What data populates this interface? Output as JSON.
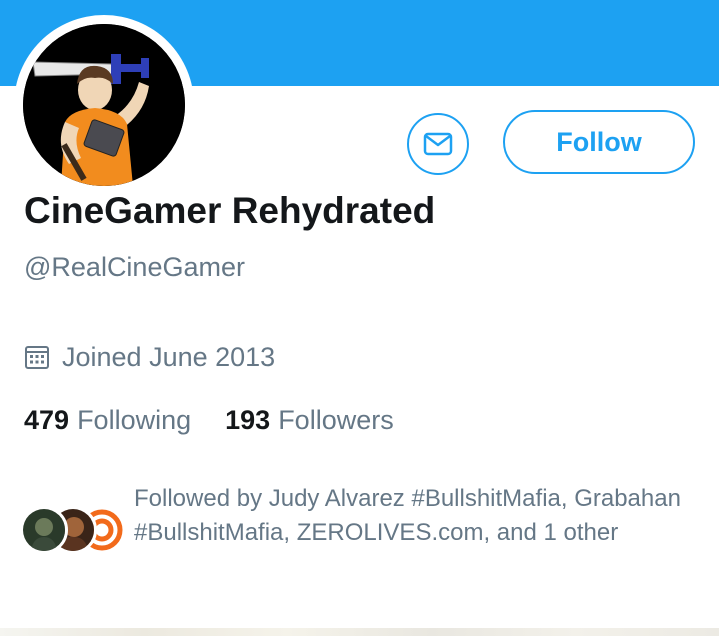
{
  "profile": {
    "display_name": "CineGamer Rehydrated",
    "handle": "@RealCineGamer",
    "joined": "Joined June 2013"
  },
  "actions": {
    "follow_label": "Follow",
    "message_icon": "envelope-icon"
  },
  "stats": [
    {
      "count": "479",
      "label": "Following"
    },
    {
      "count": "193",
      "label": "Followers"
    }
  ],
  "followed_by": {
    "text": "Followed by Judy Alvarez #BullshitMafia, Grabahan #BullshitMafia, ZEROLIVES.com, and 1 other"
  },
  "colors": {
    "accent": "#1da1f2",
    "secondary_text": "#657786",
    "primary_text": "#14171a"
  }
}
